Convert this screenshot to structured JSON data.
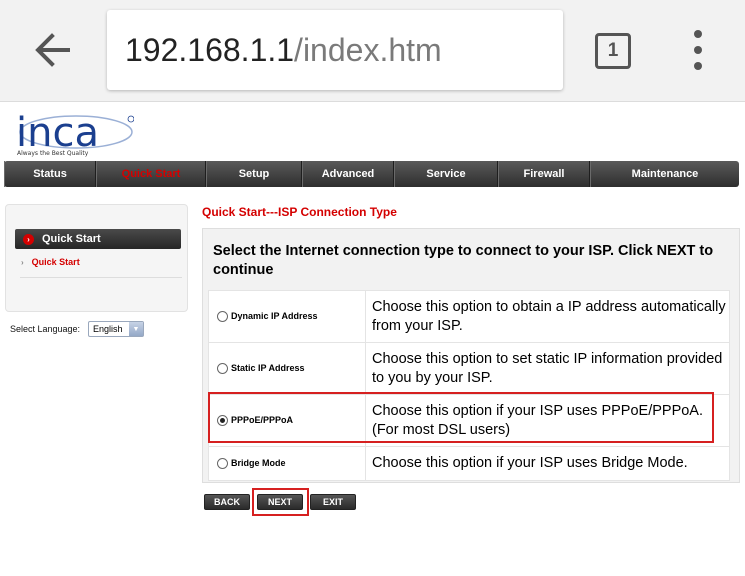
{
  "browser": {
    "url_host": "192.168.1.1",
    "url_path": "/index.htm",
    "tab_count": "1"
  },
  "brand": {
    "logo_text": "inca",
    "tagline": "Always the Best Quality"
  },
  "nav": {
    "items": [
      {
        "label": "Status"
      },
      {
        "label": "Quick Start",
        "active": true
      },
      {
        "label": "Setup"
      },
      {
        "label": "Advanced"
      },
      {
        "label": "Service"
      },
      {
        "label": "Firewall"
      },
      {
        "label": "Maintenance"
      }
    ]
  },
  "sidebar": {
    "header": "Quick Start",
    "link": "Quick Start",
    "language_label": "Select Language:",
    "language_value": "English"
  },
  "main": {
    "title": "Quick Start---ISP Connection Type",
    "instructions": "Select the Internet connection type to connect to your ISP. Click NEXT to continue",
    "options": [
      {
        "label": "Dynamic IP Address",
        "description": "Choose this option to obtain a IP address automatically from your ISP.",
        "selected": false
      },
      {
        "label": "Static IP Address",
        "description": "Choose this option to set static IP information provided to you by your ISP.",
        "selected": false
      },
      {
        "label": "PPPoE/PPPoA",
        "description": "Choose this option if your ISP uses PPPoE/PPPoA. (For most DSL users)",
        "selected": true
      },
      {
        "label": "Bridge Mode",
        "description": "Choose this option if your ISP uses Bridge Mode.",
        "selected": false
      }
    ],
    "buttons": {
      "back": "BACK",
      "next": "NEXT",
      "exit": "EXIT"
    }
  },
  "colors": {
    "accent_red": "#d40000",
    "highlight_red": "#d62020",
    "nav_dark": "#2e2e2e",
    "logo_blue": "#1b3f8f"
  }
}
